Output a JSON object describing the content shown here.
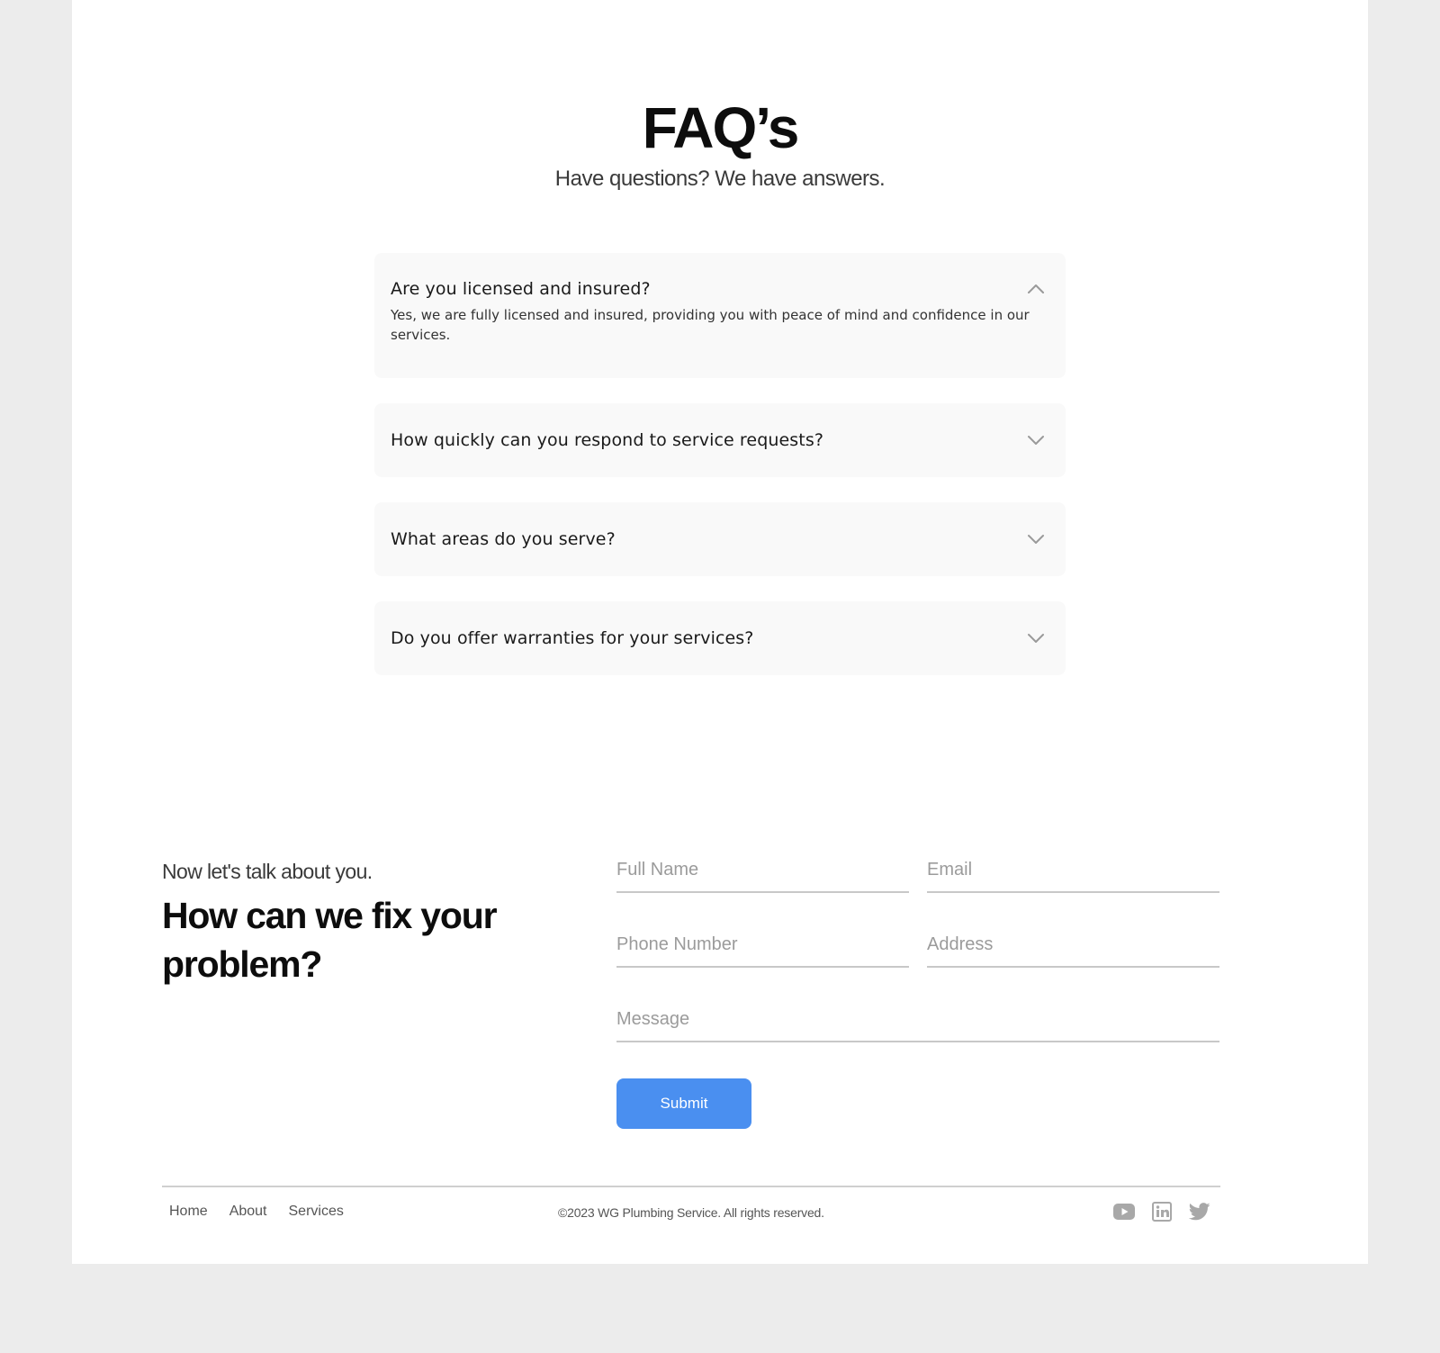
{
  "faq": {
    "title": "FAQ’s",
    "subtitle": "Have questions? We have answers.",
    "items": [
      {
        "question": "Are you licensed and insured?",
        "answer": "Yes, we are fully licensed and insured, providing you with peace of mind and confidence in our services.",
        "expanded": true,
        "icon": "chevron-up-icon"
      },
      {
        "question": "How quickly can you respond to service requests?",
        "expanded": false,
        "icon": "chevron-down-icon"
      },
      {
        "question": "What areas do you serve?",
        "expanded": false,
        "icon": "chevron-down-icon"
      },
      {
        "question": "Do you offer warranties for your services?",
        "expanded": false,
        "icon": "chevron-down-icon"
      }
    ]
  },
  "contact": {
    "intro": "Now let's talk about you.",
    "heading": "How can we fix your problem?",
    "fields": {
      "full_name": {
        "placeholder": "Full Name",
        "value": ""
      },
      "email": {
        "placeholder": "Email",
        "value": ""
      },
      "phone": {
        "placeholder": "Phone Number",
        "value": ""
      },
      "address": {
        "placeholder": "Address",
        "value": ""
      },
      "message": {
        "placeholder": "Message",
        "value": ""
      }
    },
    "submit_label": "Submit"
  },
  "footer": {
    "nav": [
      "Home",
      "About",
      "Services"
    ],
    "copyright": "©2023 WG Plumbing Service. All rights reserved.",
    "socials": [
      "youtube-icon",
      "linkedin-icon",
      "twitter-icon"
    ]
  },
  "colors": {
    "accent": "#4a8ff0",
    "page_background": "#ececec",
    "card_background": "#f9f9f9",
    "icon_gray": "#a8a8a8"
  }
}
